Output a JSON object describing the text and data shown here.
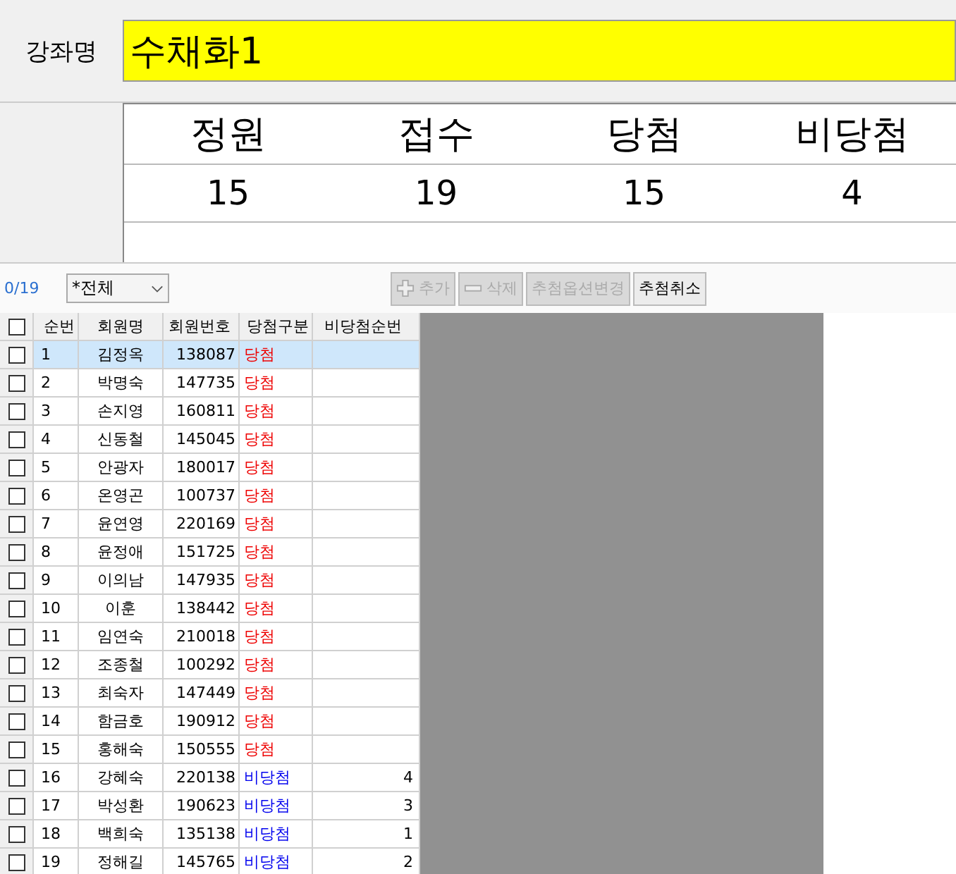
{
  "course": {
    "label": "강좌명",
    "value": "수채화1"
  },
  "summary": {
    "columns": [
      "정원",
      "접수",
      "당첨",
      "비당첨"
    ],
    "values": [
      "15",
      "19",
      "15",
      "4"
    ]
  },
  "toolbar": {
    "count": "0/19",
    "filter": "*전체",
    "buttons": [
      {
        "label": "추가",
        "kind": "add",
        "disabled": true
      },
      {
        "label": "삭제",
        "kind": "delete",
        "disabled": true
      },
      {
        "label": "추첨옵션변경",
        "kind": "text",
        "disabled": true
      },
      {
        "label": "추첨취소",
        "kind": "text",
        "disabled": false
      }
    ]
  },
  "grid": {
    "all_checked": false,
    "columns": [
      "순번",
      "회원명",
      "회원번호",
      "당첨구분",
      "비당첨순번"
    ],
    "rows": [
      {
        "no": "1",
        "name": "김정옥",
        "member_no": "138087",
        "result": "당첨",
        "won": true,
        "order": "",
        "checked": false,
        "selected": true
      },
      {
        "no": "2",
        "name": "박명숙",
        "member_no": "147735",
        "result": "당첨",
        "won": true,
        "order": "",
        "checked": false,
        "selected": false
      },
      {
        "no": "3",
        "name": "손지영",
        "member_no": "160811",
        "result": "당첨",
        "won": true,
        "order": "",
        "checked": false,
        "selected": false
      },
      {
        "no": "4",
        "name": "신동철",
        "member_no": "145045",
        "result": "당첨",
        "won": true,
        "order": "",
        "checked": false,
        "selected": false
      },
      {
        "no": "5",
        "name": "안광자",
        "member_no": "180017",
        "result": "당첨",
        "won": true,
        "order": "",
        "checked": false,
        "selected": false
      },
      {
        "no": "6",
        "name": "온영곤",
        "member_no": "100737",
        "result": "당첨",
        "won": true,
        "order": "",
        "checked": false,
        "selected": false
      },
      {
        "no": "7",
        "name": "윤연영",
        "member_no": "220169",
        "result": "당첨",
        "won": true,
        "order": "",
        "checked": false,
        "selected": false
      },
      {
        "no": "8",
        "name": "윤정애",
        "member_no": "151725",
        "result": "당첨",
        "won": true,
        "order": "",
        "checked": false,
        "selected": false
      },
      {
        "no": "9",
        "name": "이의남",
        "member_no": "147935",
        "result": "당첨",
        "won": true,
        "order": "",
        "checked": false,
        "selected": false
      },
      {
        "no": "10",
        "name": "이훈",
        "member_no": "138442",
        "result": "당첨",
        "won": true,
        "order": "",
        "checked": false,
        "selected": false
      },
      {
        "no": "11",
        "name": "임연숙",
        "member_no": "210018",
        "result": "당첨",
        "won": true,
        "order": "",
        "checked": false,
        "selected": false
      },
      {
        "no": "12",
        "name": "조종철",
        "member_no": "100292",
        "result": "당첨",
        "won": true,
        "order": "",
        "checked": false,
        "selected": false
      },
      {
        "no": "13",
        "name": "최숙자",
        "member_no": "147449",
        "result": "당첨",
        "won": true,
        "order": "",
        "checked": false,
        "selected": false
      },
      {
        "no": "14",
        "name": "함금호",
        "member_no": "190912",
        "result": "당첨",
        "won": true,
        "order": "",
        "checked": false,
        "selected": false
      },
      {
        "no": "15",
        "name": "홍해숙",
        "member_no": "150555",
        "result": "당첨",
        "won": true,
        "order": "",
        "checked": false,
        "selected": false
      },
      {
        "no": "16",
        "name": "강혜숙",
        "member_no": "220138",
        "result": "비당첨",
        "won": false,
        "order": "4",
        "checked": false,
        "selected": false
      },
      {
        "no": "17",
        "name": "박성환",
        "member_no": "190623",
        "result": "비당첨",
        "won": false,
        "order": "3",
        "checked": false,
        "selected": false
      },
      {
        "no": "18",
        "name": "백희숙",
        "member_no": "135138",
        "result": "비당첨",
        "won": false,
        "order": "1",
        "checked": false,
        "selected": false
      },
      {
        "no": "19",
        "name": "정해길",
        "member_no": "145765",
        "result": "비당첨",
        "won": false,
        "order": "2",
        "checked": false,
        "selected": false
      }
    ]
  }
}
